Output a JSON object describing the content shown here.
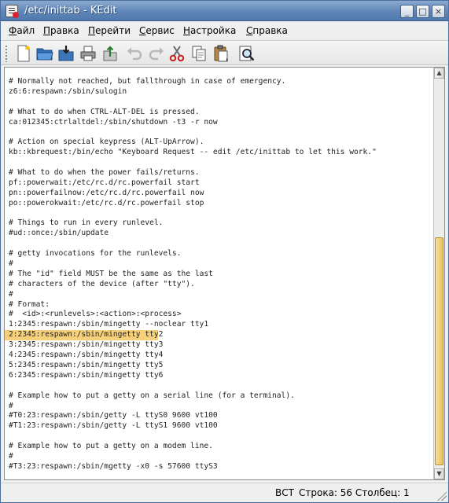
{
  "window": {
    "title": "/etc/inittab - KEdit"
  },
  "titlebar_buttons": {
    "minimize": "_",
    "maximize": "□",
    "close": "×"
  },
  "menubar": {
    "items": [
      {
        "underline": "Ф",
        "rest": "айл"
      },
      {
        "underline": "П",
        "rest": "равка"
      },
      {
        "underline": "П",
        "rest": "ерейти"
      },
      {
        "underline": "С",
        "rest": "ервис"
      },
      {
        "underline": "Н",
        "rest": "астройка"
      },
      {
        "underline": "С",
        "rest": "правка"
      }
    ]
  },
  "toolbar": {
    "icons": [
      "new-document-icon",
      "open-folder-icon",
      "save-icon",
      "print-icon",
      "upload-icon",
      "undo-icon",
      "redo-icon",
      "cut-icon",
      "copy-icon",
      "paste-icon",
      "find-icon"
    ]
  },
  "editor": {
    "highlighted_line_index": 25,
    "lines": [
      "# Normally not reached, but fallthrough in case of emergency.",
      "z6:6:respawn:/sbin/sulogin",
      "",
      "# What to do when CTRL-ALT-DEL is pressed.",
      "ca:012345:ctrlaltdel:/sbin/shutdown -t3 -r now",
      "",
      "# Action on special keypress (ALT-UpArrow).",
      "kb::kbrequest:/bin/echo \"Keyboard Request -- edit /etc/inittab to let this work.\"",
      "",
      "# What to do when the power fails/returns.",
      "pf::powerwait:/etc/rc.d/rc.powerfail start",
      "pn::powerfailnow:/etc/rc.d/rc.powerfail now",
      "po::powerokwait:/etc/rc.d/rc.powerfail stop",
      "",
      "# Things to run in every runlevel.",
      "#ud::once:/sbin/update",
      "",
      "# getty invocations for the runlevels.",
      "#",
      "# The \"id\" field MUST be the same as the last",
      "# characters of the device (after \"tty\").",
      "#",
      "# Format:",
      "#  <id>:<runlevels>:<action>:<process>",
      "1:2345:respawn:/sbin/mingetty --noclear tty1",
      "2:2345:respawn:/sbin/mingetty tty2",
      "3:2345:respawn:/sbin/mingetty tty3",
      "4:2345:respawn:/sbin/mingetty tty4",
      "5:2345:respawn:/sbin/mingetty tty5",
      "6:2345:respawn:/sbin/mingetty tty6",
      "",
      "# Example how to put a getty on a serial line (for a terminal).",
      "#",
      "#T0:23:respawn:/sbin/getty -L ttyS0 9600 vt100",
      "#T1:23:respawn:/sbin/getty -L ttyS1 9600 vt100",
      "",
      "# Example how to put a getty on a modem line.",
      "#",
      "#T3:23:respawn:/sbin/mgetty -x0 -s 57600 ttyS3"
    ]
  },
  "statusbar": {
    "mode": "ВСТ",
    "position": "Строка: 56 Столбец: 1"
  }
}
